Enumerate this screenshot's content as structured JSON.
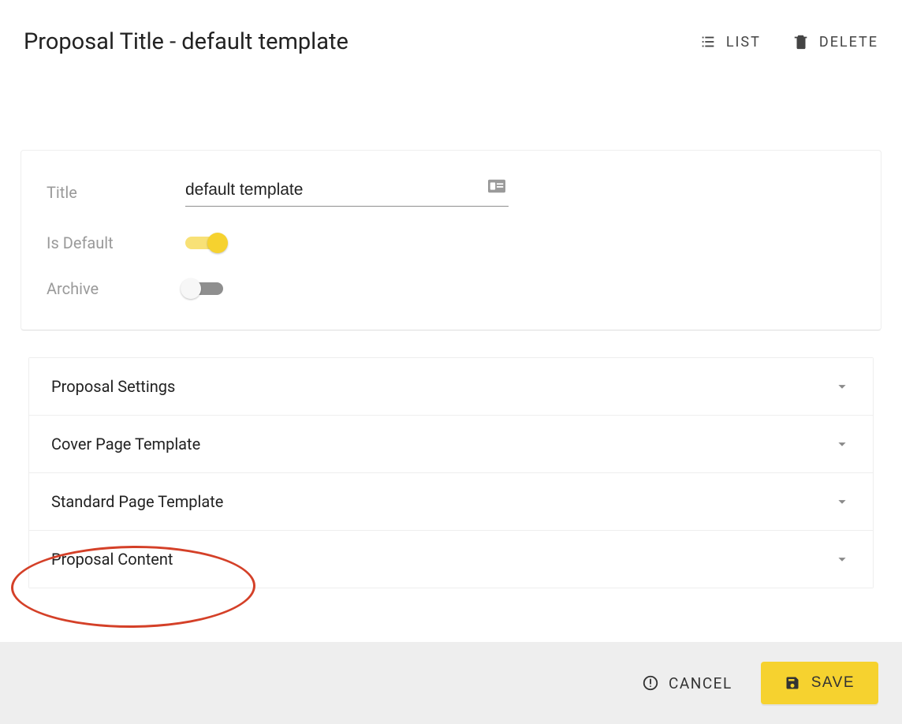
{
  "header": {
    "title": "Proposal Title - default template",
    "list_label": "LIST",
    "delete_label": "DELETE"
  },
  "form": {
    "title_label": "Title",
    "title_value": "default template",
    "is_default_label": "Is Default",
    "is_default_on": true,
    "archive_label": "Archive",
    "archive_on": false
  },
  "panels": [
    {
      "label": "Proposal Settings"
    },
    {
      "label": "Cover Page Template"
    },
    {
      "label": "Standard Page Template"
    },
    {
      "label": "Proposal Content"
    }
  ],
  "footer": {
    "cancel_label": "CANCEL",
    "save_label": "SAVE"
  },
  "annotation": {
    "highlighted_panel_index": 3
  },
  "colors": {
    "accent": "#f6d22f",
    "highlight_ring": "#d44028"
  }
}
